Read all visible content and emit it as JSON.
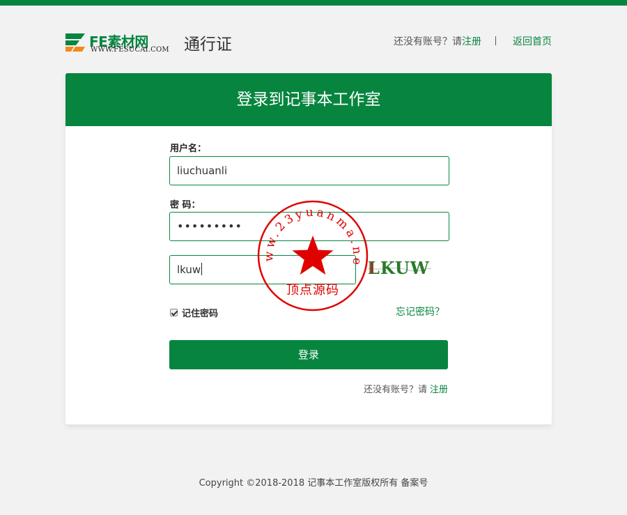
{
  "header": {
    "logo_main": "FE",
    "logo_cn": "素材网",
    "logo_url": "WWW.FESUCAI.COM",
    "subtitle": "通行证",
    "no_account_text": "还没有账号？请",
    "register_link": "注册",
    "home_link": "返回首页"
  },
  "card": {
    "title": "登录到记事本工作室",
    "username_label": "用户名：",
    "username_value": "liuchuanli",
    "password_label": "密 码：",
    "password_value": "•••••••••",
    "captcha_value": "lkuw",
    "captcha_image_text": "LKUW",
    "remember_label": "记住密码",
    "forgot_link": "忘记密码？",
    "login_button": "登录",
    "no_account_text": "还没有账号？请",
    "register_link": "注册"
  },
  "stamp": {
    "url_text": "www.23yuanma.net",
    "name_text": "顶点源码"
  },
  "footer": {
    "copyright": "Copyright ©2018-2018 记事本工作室版权所有 备案号"
  },
  "colors": {
    "brand_green": "#07853f",
    "logo_orange": "#f08a1c",
    "stamp_red": "#e00000"
  }
}
